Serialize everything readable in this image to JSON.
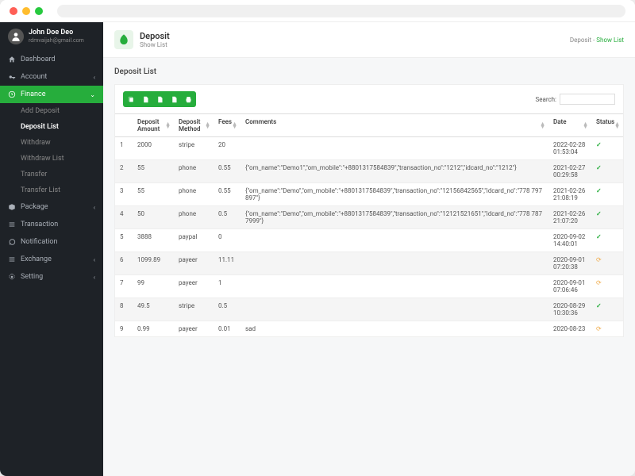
{
  "user": {
    "name": "John Doe Deo",
    "email": "rdmvaijah@gmail.com"
  },
  "nav": {
    "dashboard": "Dashboard",
    "account": "Account",
    "finance": "Finance",
    "finance_sub": {
      "add_deposit": "Add Deposit",
      "deposit_list": "Deposit List",
      "withdraw": "Withdraw",
      "withdraw_list": "Withdraw List",
      "transfer": "Transfer",
      "transfer_list": "Transfer List"
    },
    "package": "Package",
    "transaction": "Transaction",
    "notification": "Notification",
    "exchange": "Exchange",
    "setting": "Setting"
  },
  "header": {
    "title": "Deposit",
    "subtitle": "Show List"
  },
  "breadcrumb": {
    "root": "Deposit",
    "sep": "-",
    "current": "Show List"
  },
  "panel_title": "Deposit List",
  "search_label": "Search:",
  "columns": {
    "amount": "Deposit Amount",
    "method": "Deposit Method",
    "fees": "Fees",
    "comments": "Comments",
    "date": "Date",
    "status": "Status"
  },
  "rows": [
    {
      "idx": "1",
      "amount": "2000",
      "method": "stripe",
      "fees": "20",
      "comments": "",
      "date": "2022-02-28 01:53:04",
      "status": "ok"
    },
    {
      "idx": "2",
      "amount": "55",
      "method": "phone",
      "fees": "0.55",
      "comments": "{\"om_name\":\"Demo1\",\"om_mobile\":\"+8801317584839\",\"transaction_no\":\"1212\",\"idcard_no\":\"1212\"}",
      "date": "2021-02-27 00:29:58",
      "status": "ok"
    },
    {
      "idx": "3",
      "amount": "55",
      "method": "phone",
      "fees": "0.55",
      "comments": "{\"om_name\":\"Demo\",\"om_mobile\":\"+8801317584839\",\"transaction_no\":\"12156842565\",\"idcard_no\":\"778 797 897\"}",
      "date": "2021-02-26 21:08:19",
      "status": "ok"
    },
    {
      "idx": "4",
      "amount": "50",
      "method": "phone",
      "fees": "0.5",
      "comments": "{\"om_name\":\"Demo\",\"om_mobile\":\"+8801317584839\",\"transaction_no\":\"12121521651\",\"idcard_no\":\"778 787 7999\"}",
      "date": "2021-02-26 21:07:20",
      "status": "ok"
    },
    {
      "idx": "5",
      "amount": "3888",
      "method": "paypal",
      "fees": "0",
      "comments": "",
      "date": "2020-09-02 14:40:01",
      "status": "ok"
    },
    {
      "idx": "6",
      "amount": "1099.89",
      "method": "payeer",
      "fees": "11.11",
      "comments": "",
      "date": "2020-09-01 07:20:38",
      "status": "pending"
    },
    {
      "idx": "7",
      "amount": "99",
      "method": "payeer",
      "fees": "1",
      "comments": "",
      "date": "2020-09-01 07:06:46",
      "status": "pending"
    },
    {
      "idx": "8",
      "amount": "49.5",
      "method": "stripe",
      "fees": "0.5",
      "comments": "",
      "date": "2020-08-29 10:30:36",
      "status": "ok"
    },
    {
      "idx": "9",
      "amount": "0.99",
      "method": "payeer",
      "fees": "0.01",
      "comments": "sad",
      "date": "2020-08-23",
      "status": "pending"
    }
  ]
}
